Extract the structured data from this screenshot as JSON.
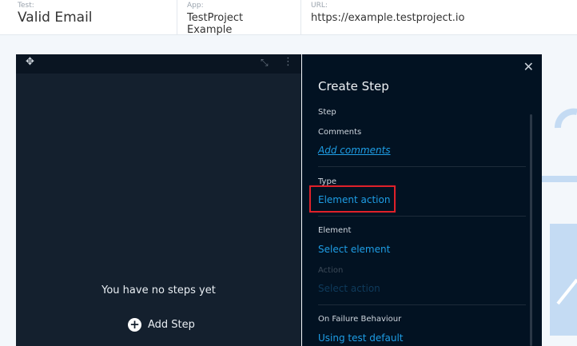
{
  "header": {
    "test_label": "Test:",
    "test_value": "Valid Email",
    "app_label": "App:",
    "app_value": "TestProject Example",
    "url_label": "URL:",
    "url_value": "https://example.testproject.io"
  },
  "steps_panel": {
    "empty_text": "You have no steps yet",
    "add_step": "Add Step"
  },
  "create_step": {
    "title": "Create Step",
    "step_label": "Step",
    "comments_label": "Comments",
    "add_comments": "Add comments",
    "type_label": "Type",
    "type_value": "Element action",
    "element_label": "Element",
    "element_value": "Select element",
    "action_label": "Action",
    "action_value": "Select action",
    "failure_label": "On Failure Behaviour",
    "failure_value": "Using test default"
  },
  "colors": {
    "accent": "#1e9ee6",
    "highlight": "#e0212a",
    "panel": "#021222"
  }
}
